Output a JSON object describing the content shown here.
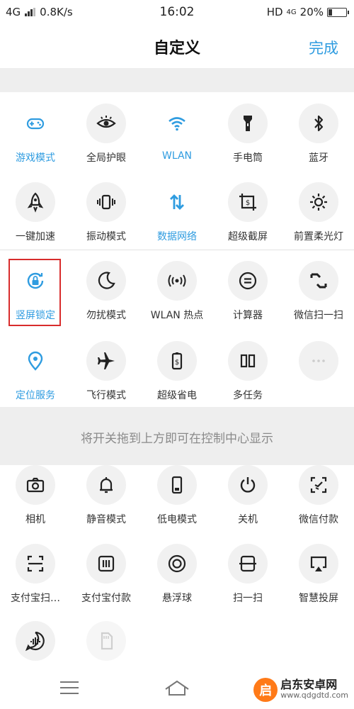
{
  "status": {
    "network": "4G",
    "speed": "0.8K/s",
    "time": "16:02",
    "hd": "HD",
    "net2": "4G",
    "battery": "20%",
    "battery_level": 0.2
  },
  "header": {
    "title": "自定义",
    "done": "完成"
  },
  "active_tiles": [
    {
      "label": "游戏模式",
      "icon": "gamepad-icon",
      "active": true
    },
    {
      "label": "全局护眼",
      "icon": "eye-icon",
      "active": false
    },
    {
      "label": "WLAN",
      "icon": "wifi-icon",
      "active": true
    },
    {
      "label": "手电筒",
      "icon": "flashlight-icon",
      "active": false
    },
    {
      "label": "蓝牙",
      "icon": "bluetooth-icon",
      "active": false
    },
    {
      "label": "一键加速",
      "icon": "rocket-icon",
      "active": false
    },
    {
      "label": "振动模式",
      "icon": "vibrate-icon",
      "active": false
    },
    {
      "label": "数据网络",
      "icon": "data-arrows-icon",
      "active": true
    },
    {
      "label": "超级截屏",
      "icon": "screenshot-icon",
      "active": false
    },
    {
      "label": "前置柔光灯",
      "icon": "sun-icon",
      "active": false
    },
    {
      "label": "竖屏锁定",
      "icon": "rotation-lock-icon",
      "active": true
    },
    {
      "label": "勿扰模式",
      "icon": "moon-icon",
      "active": false
    },
    {
      "label": "WLAN 热点",
      "icon": "hotspot-icon",
      "active": false
    },
    {
      "label": "计算器",
      "icon": "calculator-icon",
      "active": false
    },
    {
      "label": "微信扫一扫",
      "icon": "wechat-scan-icon",
      "active": false
    },
    {
      "label": "定位服务",
      "icon": "location-pin-icon",
      "active": true
    },
    {
      "label": "飞行模式",
      "icon": "airplane-icon",
      "active": false
    },
    {
      "label": "超级省电",
      "icon": "battery-saver-icon",
      "active": false
    },
    {
      "label": "多任务",
      "icon": "multitask-icon",
      "active": false
    },
    {
      "label": "",
      "icon": "more-dots-icon",
      "active": false
    }
  ],
  "hint": "将开关拖到上方即可在控制中心显示",
  "inactive_tiles": [
    {
      "label": "相机",
      "icon": "camera-icon"
    },
    {
      "label": "静音模式",
      "icon": "bell-icon"
    },
    {
      "label": "低电模式",
      "icon": "phone-battery-icon"
    },
    {
      "label": "关机",
      "icon": "power-icon"
    },
    {
      "label": "微信付款",
      "icon": "wechat-pay-icon"
    },
    {
      "label": "支付宝扫…",
      "icon": "alipay-scan-icon"
    },
    {
      "label": "支付宝付款",
      "icon": "alipay-pay-icon"
    },
    {
      "label": "悬浮球",
      "icon": "float-ball-icon"
    },
    {
      "label": "扫一扫",
      "icon": "scan-icon"
    },
    {
      "label": "智慧投屏",
      "icon": "cast-icon"
    },
    {
      "label": "",
      "icon": "voice-icon"
    },
    {
      "label": "",
      "icon": "sd-card-icon"
    }
  ],
  "watermark": {
    "logo": "启",
    "name": "启东安卓网",
    "url": "www.qdgdtd.com"
  },
  "colors": {
    "accent": "#2f9ce0",
    "highlight": "#d82c2c",
    "band": "#eeeeee"
  }
}
